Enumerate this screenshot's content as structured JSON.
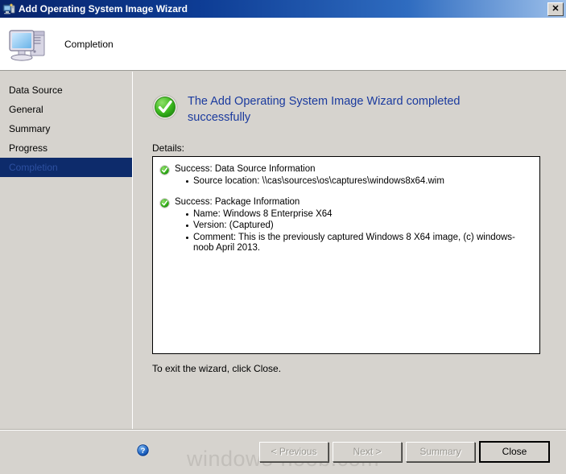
{
  "window": {
    "title": "Add Operating System Image Wizard",
    "icon": "wizard-computer-icon",
    "close_glyph": "✕"
  },
  "header": {
    "icon": "computer-icon",
    "title": "Completion"
  },
  "sidebar": {
    "items": [
      {
        "label": "Data Source",
        "selected": false
      },
      {
        "label": "General",
        "selected": false
      },
      {
        "label": "Summary",
        "selected": false
      },
      {
        "label": "Progress",
        "selected": false
      },
      {
        "label": "Completion",
        "selected": true
      }
    ],
    "selected_bg": "#0d2b6b"
  },
  "main": {
    "result_icon": "success-check-icon",
    "result_title": "The Add Operating System Image Wizard completed successfully",
    "result_title_color": "#1a3a9e",
    "details_label": "Details:",
    "details": [
      {
        "icon": "success-check-icon",
        "heading": "Success: Data Source Information",
        "bullets": [
          "Source location: \\\\cas\\sources\\os\\captures\\windows8x64.wim"
        ]
      },
      {
        "icon": "success-check-icon",
        "heading": "Success: Package Information",
        "bullets": [
          "Name: Windows 8 Enterprise X64",
          "Version: (Captured)",
          "Comment: This is the previously captured Windows 8 X64 image, (c) windows-noob April 2013."
        ]
      }
    ],
    "exit_note": "To exit the wizard, click Close."
  },
  "footer": {
    "help_icon": "help-question-icon",
    "buttons": [
      {
        "label": "< Previous",
        "enabled": false,
        "default": false
      },
      {
        "label": "Next >",
        "enabled": false,
        "default": false
      },
      {
        "label": "Summary",
        "enabled": false,
        "default": false
      },
      {
        "label": "Close",
        "enabled": true,
        "default": true
      }
    ]
  },
  "watermark": {
    "text": "windows-noob.com",
    "color": "#c2bfba"
  }
}
